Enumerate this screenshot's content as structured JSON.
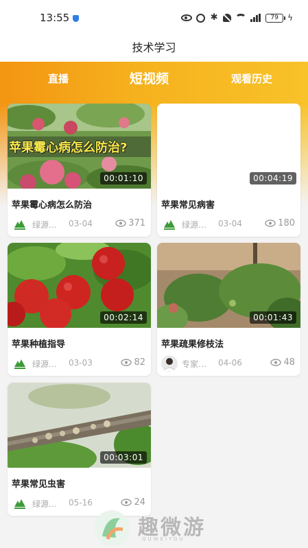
{
  "status": {
    "time": "13:55",
    "battery": "79"
  },
  "header": {
    "title": "技术学习"
  },
  "tabs": [
    {
      "label": "直播"
    },
    {
      "label": "短视频"
    },
    {
      "label": "观看历史"
    }
  ],
  "videos": [
    {
      "title": "苹果霉心病怎么防治",
      "thumb_caption": "苹果霉心病怎么防治?",
      "duration": "00:01:10",
      "author": "绿源…",
      "date": "03-04",
      "views": "371"
    },
    {
      "title": "苹果常见病害",
      "duration": "00:04:19",
      "author": "绿源…",
      "date": "03-04",
      "views": "180"
    },
    {
      "title": "苹果种植指导",
      "duration": "00:02:14",
      "author": "绿源…",
      "date": "03-03",
      "views": "82"
    },
    {
      "title": "苹果疏果修枝法",
      "duration": "00:01:43",
      "author": "专家…",
      "date": "04-06",
      "views": "48"
    },
    {
      "title": "苹果常见虫害",
      "duration": "00:03:01",
      "author": "绿源…",
      "date": "05-16",
      "views": "24"
    }
  ],
  "watermark": {
    "text": "趣微游",
    "sub": "QUWEIYOU"
  },
  "colors": {
    "accent_orange": "#f39512",
    "accent_yellow": "#f8c229",
    "logo_green": "#3d9b3a"
  }
}
